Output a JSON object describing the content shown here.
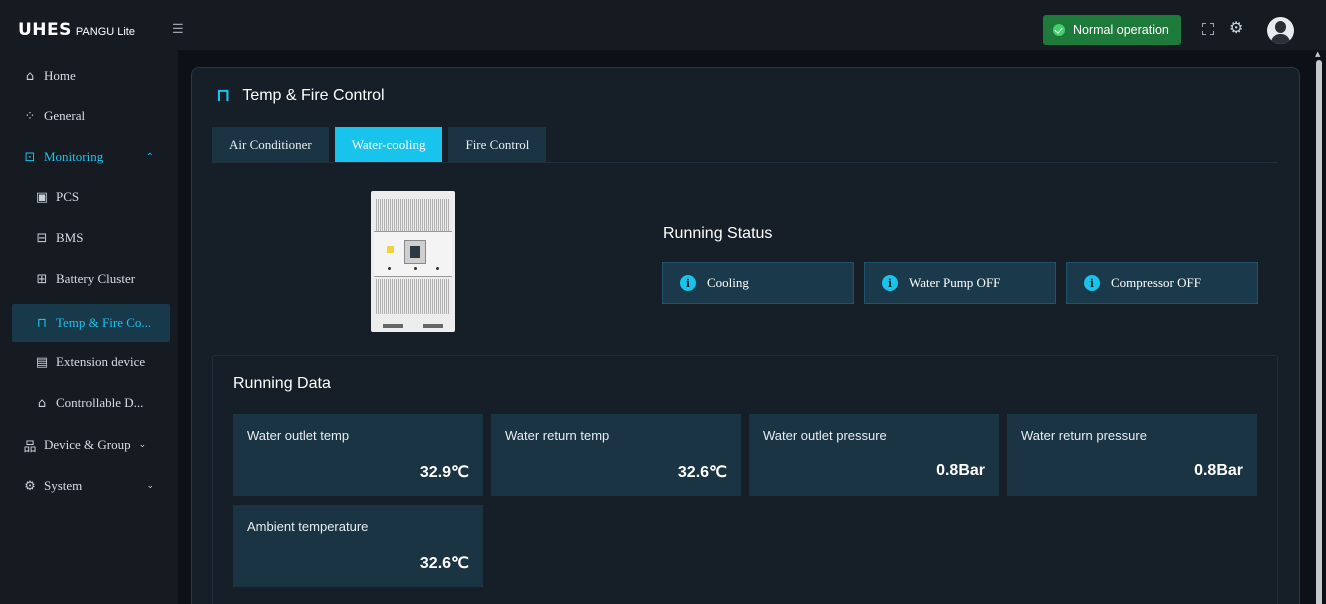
{
  "app": {
    "logo_main": "UHES",
    "logo_sub": "PANGU Lite"
  },
  "header": {
    "status": "Normal operation"
  },
  "sidebar": {
    "items": [
      {
        "label": "Home",
        "icon": "home-icon"
      },
      {
        "label": "General",
        "icon": "grid-icon"
      },
      {
        "label": "Monitoring",
        "icon": "monitor-icon",
        "expanded": true
      },
      {
        "label": "PCS",
        "icon": "pcs-icon"
      },
      {
        "label": "BMS",
        "icon": "battery-icon"
      },
      {
        "label": "Battery Cluster",
        "icon": "battery-cluster-icon"
      },
      {
        "label": "Temp & Fire Co...",
        "icon": "fire-extinguisher-icon",
        "selected": true
      },
      {
        "label": "Extension device",
        "icon": "extension-icon"
      },
      {
        "label": "Controllable D...",
        "icon": "controllable-device-icon"
      },
      {
        "label": "Device & Group",
        "icon": "device-group-icon"
      },
      {
        "label": "System",
        "icon": "gear-icon"
      }
    ]
  },
  "main": {
    "title": "Temp & Fire Control",
    "tabs": [
      {
        "label": "Air Conditioner"
      },
      {
        "label": "Water-cooling",
        "active": true
      },
      {
        "label": "Fire Control"
      }
    ],
    "running_status": {
      "title": "Running Status",
      "items": [
        "Cooling",
        "Water Pump OFF",
        "Compressor OFF"
      ]
    },
    "running_data": {
      "title": "Running Data",
      "cards": [
        {
          "label": "Water outlet temp",
          "value": "32.9℃"
        },
        {
          "label": "Water return temp",
          "value": "32.6℃"
        },
        {
          "label": "Water outlet pressure",
          "value": "0.8Bar"
        },
        {
          "label": "Water return pressure",
          "value": "0.8Bar"
        },
        {
          "label": "Ambient temperature",
          "value": "32.6℃"
        }
      ]
    }
  },
  "colors": {
    "accent": "#19c4ec",
    "status_green": "#1e7a3a",
    "background": "#0d1117",
    "card": "#1b3443"
  }
}
